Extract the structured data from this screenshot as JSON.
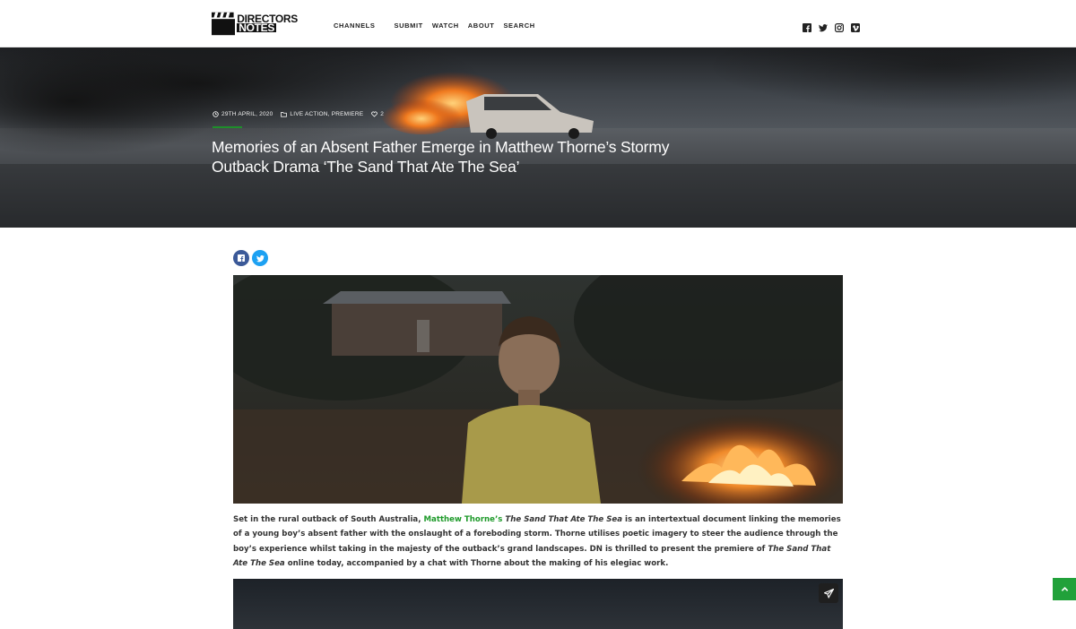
{
  "logo": {
    "line1": "DIRECTORS",
    "line2": "NOTES"
  },
  "nav": [
    "CHANNELS",
    "SUBMIT",
    "WATCH",
    "ABOUT",
    "SEARCH"
  ],
  "social_icons": [
    "facebook-icon",
    "twitter-icon",
    "instagram-icon",
    "vimeo-icon"
  ],
  "article": {
    "date": "29TH APRIL, 2020",
    "categories": "LIVE ACTION, PREMIERE",
    "likes": "2",
    "title": "Memories of an Absent Father Emerge in Matthew Thorne’s Stormy Outback Drama ‘The Sand That Ate The Sea’",
    "intro": {
      "p1": "Set in the rural outback of South Australia, ",
      "link": "Matthew Thorne’s",
      "p2": " ",
      "film1": "The Sand That Ate The Sea",
      "p3": " is an intertextual document linking the memories of a young boy’s absent father with the onslaught of a foreboding storm. Thorne utilises poetic imagery to steer the audience through the boy’s experience whilst taking in the majesty of the outback’s grand landscapes. DN is thrilled to present the premiere of ",
      "film2": "The Sand That Ate The Sea",
      "p4": " online today, accompanied by a chat with Thorne about the making of his elegiac work."
    }
  },
  "share_icons": [
    "facebook-icon",
    "twitter-icon"
  ],
  "colors": {
    "accent": "#1e9a2a",
    "facebook": "#3b5998",
    "twitter": "#1da1f2",
    "to_top": "#21a13a"
  }
}
